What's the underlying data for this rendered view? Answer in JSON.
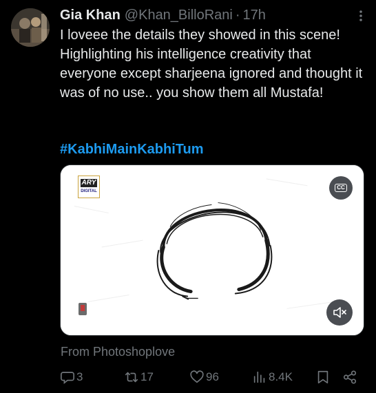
{
  "tweet": {
    "display_name": "Gia Khan",
    "handle": "@Khan_BilloRani",
    "separator": "·",
    "time": "17h",
    "text": "I loveee the details they showed in this scene! Highlighting his intelligence creativity that everyone except sharjeena ignored and thought it was of no use.. you show them all Mustafa!",
    "hashtag": "#KabhiMainKabhiTum",
    "attribution": "From Photoshoplove"
  },
  "media": {
    "logo_top": "ARY",
    "logo_bottom": "DIGITAL",
    "cc_label": "CC",
    "cc_icon": "closed-captions-icon",
    "mute_icon": "speaker-muted-icon"
  },
  "actions": {
    "replies": "3",
    "reposts": "17",
    "likes": "96",
    "views": "8.4K",
    "reply_icon": "speech-bubble-icon",
    "repost_icon": "repost-arrows-icon",
    "like_icon": "heart-icon",
    "views_icon": "bar-chart-icon",
    "bookmark_icon": "bookmark-icon",
    "share_icon": "share-icon"
  },
  "colors": {
    "background": "#000000",
    "text": "#e7e9ea",
    "muted": "#71767b",
    "link": "#1d9bf0"
  }
}
